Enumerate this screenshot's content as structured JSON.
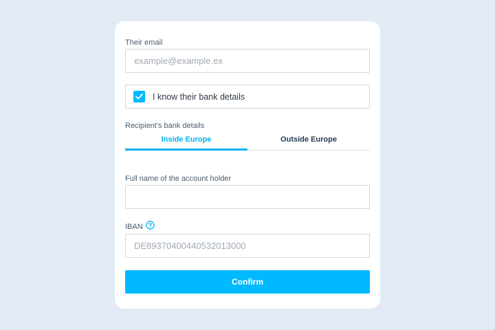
{
  "form": {
    "email": {
      "label": "Their email",
      "placeholder": "example@example.ex",
      "value": ""
    },
    "bank_details_checkbox": {
      "label": "I know their bank details",
      "checked": true
    },
    "recipient_section_label": "Recipient's bank details",
    "tabs": [
      {
        "label": "Inside Europe",
        "active": true
      },
      {
        "label": "Outside Europe",
        "active": false
      }
    ],
    "full_name": {
      "label": "Full name of the account holder",
      "placeholder": "",
      "value": ""
    },
    "iban": {
      "label": "IBAN",
      "placeholder": "DE89370400440532013000",
      "value": "",
      "help_icon": "question-circle-icon"
    },
    "confirm_label": "Confirm"
  },
  "colors": {
    "background": "#e2ebf4",
    "accent": "#00b9ff",
    "tab_active": "#00b2f0",
    "tab_inactive": "#243b53"
  }
}
